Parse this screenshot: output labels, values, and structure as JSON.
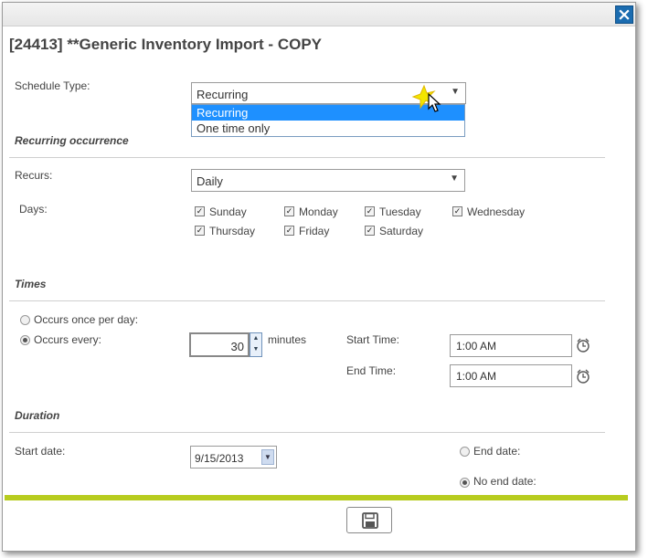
{
  "dialog": {
    "title": "[24413] **Generic Inventory Import - COPY",
    "close_icon": "close-icon"
  },
  "schedule_type": {
    "label": "Schedule Type:",
    "selected": "Recurring",
    "options": [
      "Recurring",
      "One time only"
    ],
    "highlighted_option": "Recurring"
  },
  "recurring": {
    "section_title": "Recurring occurrence",
    "recurs_label": "Recurs:",
    "recurs_value": "Daily",
    "days_label": "Days:",
    "days": [
      {
        "label": "Sunday",
        "checked": true
      },
      {
        "label": "Monday",
        "checked": true
      },
      {
        "label": "Tuesday",
        "checked": true
      },
      {
        "label": "Wednesday",
        "checked": true
      },
      {
        "label": "Thursday",
        "checked": true
      },
      {
        "label": "Friday",
        "checked": true
      },
      {
        "label": "Saturday",
        "checked": true
      }
    ]
  },
  "times": {
    "section_title": "Times",
    "once_per_day_label": "Occurs once per day:",
    "occurs_every_label": "Occurs every:",
    "interval_value": "30",
    "interval_unit": "minutes",
    "start_time_label": "Start Time:",
    "start_time_value": "1:00 AM",
    "end_time_label": "End Time:",
    "end_time_value": "1:00 AM",
    "selected_mode": "occurs-every"
  },
  "duration": {
    "section_title": "Duration",
    "start_date_label": "Start date:",
    "start_date_value": "9/15/2013",
    "end_date_label": "End date:",
    "no_end_date_label": "No end date:",
    "selected": "no-end-date"
  },
  "footer": {
    "save_icon": "save-icon",
    "accent_color": "#b7cc1f"
  },
  "colors": {
    "highlight": "#1e90ff",
    "close_button": "#1b6cb0"
  }
}
